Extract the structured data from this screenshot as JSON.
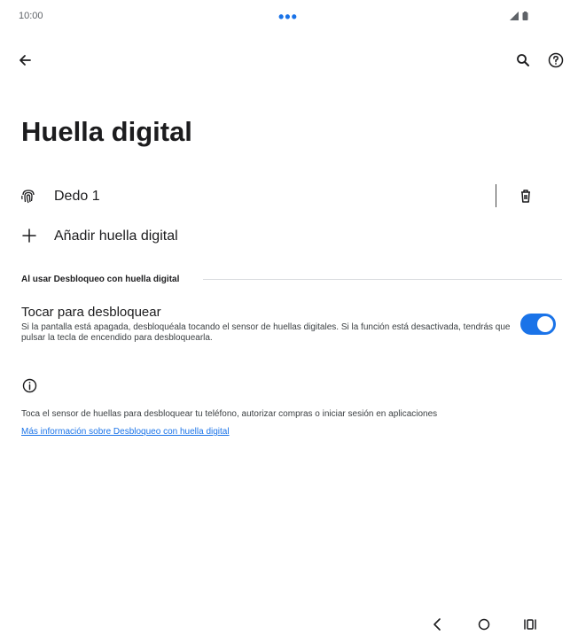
{
  "status_bar": {
    "time": "10:00",
    "center_indicator": "•••",
    "icons": [
      "signal-icon",
      "battery-icon"
    ]
  },
  "top_bar": {
    "back_icon": "arrow-left-icon",
    "search_icon": "search-icon",
    "help_icon": "help-icon"
  },
  "page": {
    "title": "Huella digital"
  },
  "fingerprints": [
    {
      "label": "Dedo 1",
      "icon": "fingerprint-icon",
      "delete_icon": "trash-icon"
    }
  ],
  "add_fingerprint": {
    "label": "Añadir huella digital",
    "icon": "plus-icon"
  },
  "section": {
    "header": "Al usar Desbloqueo con huella digital"
  },
  "touch_to_unlock": {
    "title": "Tocar para desbloquear",
    "summary": "Si la pantalla está apagada, desbloquéala tocando el sensor de huellas digitales. Si la función está desactivada, tendrás que pulsar la tecla de encendido para desbloquearla.",
    "enabled": true
  },
  "footer": {
    "info_icon": "info-icon",
    "text": "Toca el sensor de huellas para desbloquear tu teléfono, autorizar compras o iniciar sesión en aplicaciones",
    "link": "Más información sobre Desbloqueo con huella digital"
  },
  "nav_bar": {
    "icons": [
      "nav-back-icon",
      "nav-home-icon",
      "nav-recents-icon"
    ]
  },
  "colors": {
    "accent": "#1a73e8",
    "text": "#1c1c1e",
    "background": "#ffffff"
  }
}
